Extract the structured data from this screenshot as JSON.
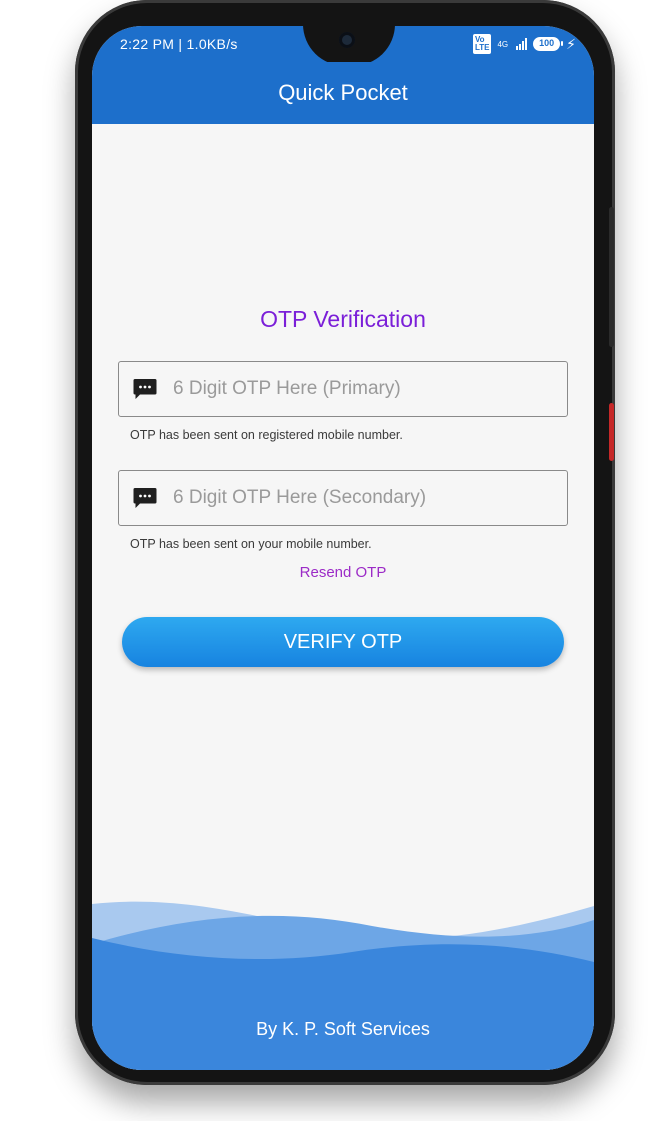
{
  "status_bar": {
    "time_speed": "2:22 PM | 1.0KB/s",
    "volte": "Vo LTE",
    "network": "4G",
    "battery": "100",
    "charging_icon": "lightning-icon"
  },
  "app_bar": {
    "title": "Quick Pocket"
  },
  "otp": {
    "heading": "OTP Verification",
    "primary": {
      "placeholder": "6 Digit OTP Here (Primary)",
      "hint": "OTP has been sent on registered mobile number.",
      "icon": "message-icon"
    },
    "secondary": {
      "placeholder": "6 Digit OTP Here (Secondary)",
      "hint": "OTP has been sent on your mobile number.",
      "icon": "message-icon"
    },
    "resend_label": "Resend OTP",
    "verify_label": "VERIFY OTP"
  },
  "footer": {
    "credit": "By K. P. Soft Services"
  },
  "colors": {
    "primary": "#1d6fcb",
    "heading": "#7b1fd8",
    "resend": "#9c2bc7",
    "button_top": "#2ea9f0",
    "button_bottom": "#1783e0"
  }
}
